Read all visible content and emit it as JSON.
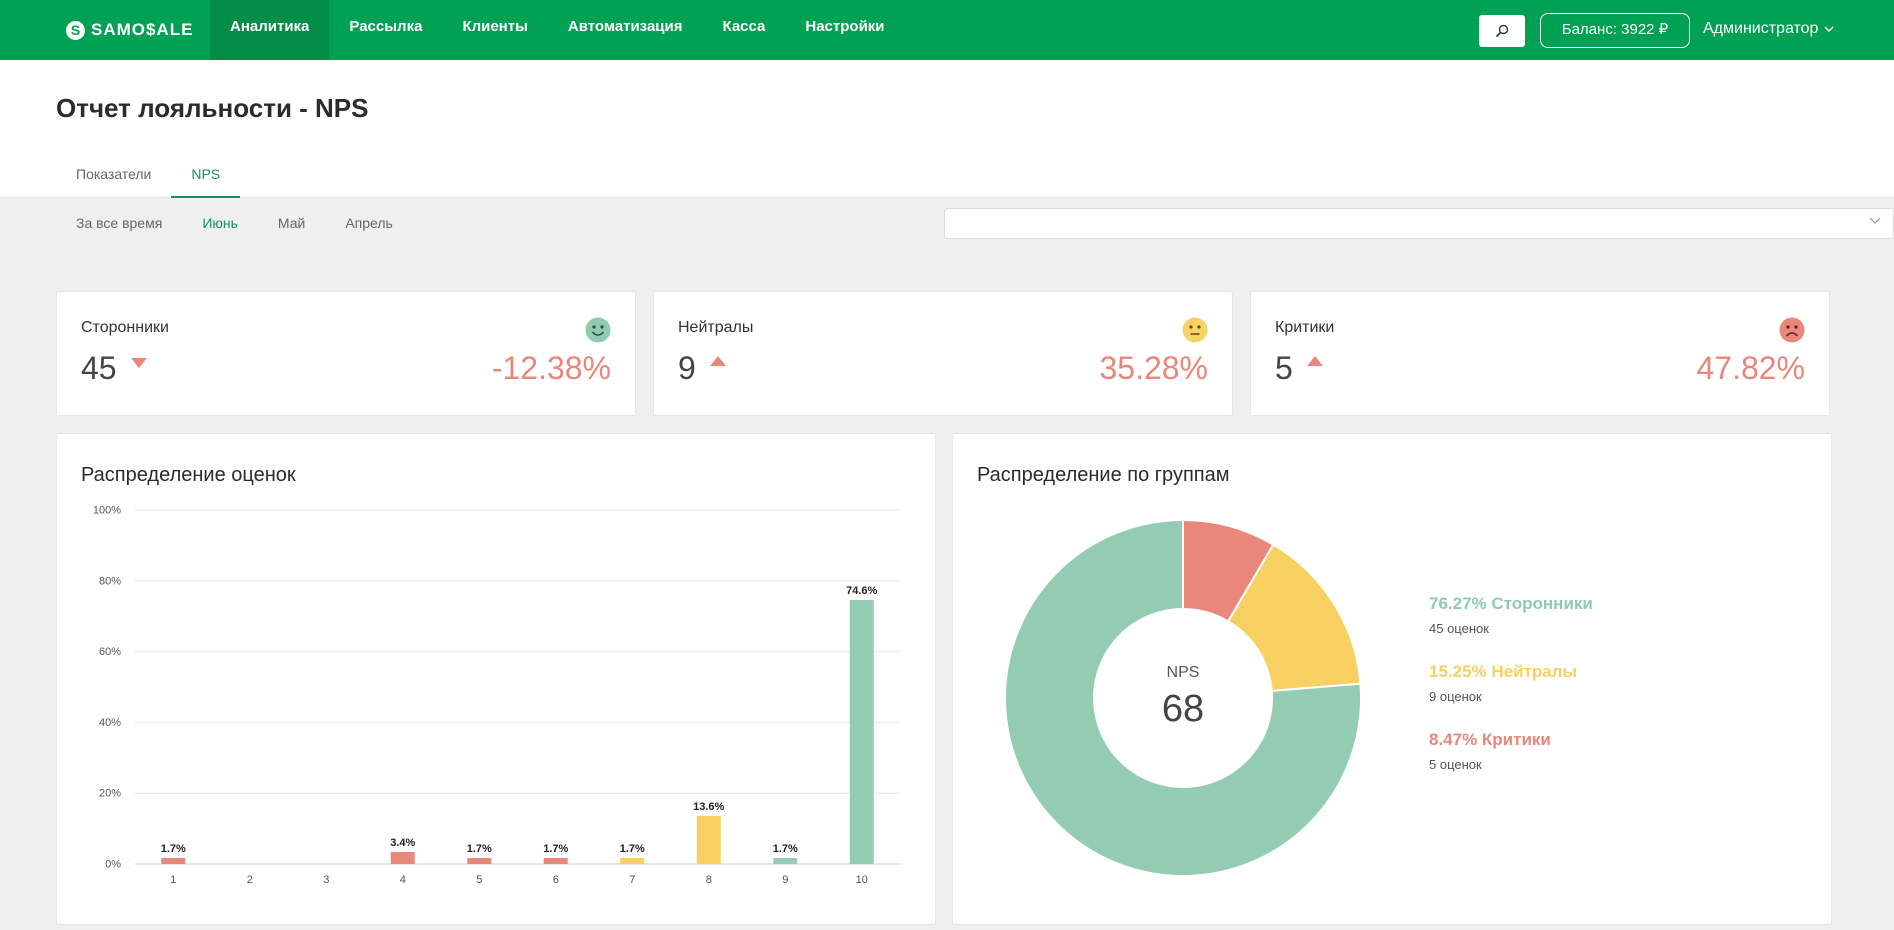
{
  "nav": {
    "logo": "SAMO$ALE",
    "logo_mark": "S",
    "items": [
      {
        "label": "Аналитика",
        "active": true
      },
      {
        "label": "Рассылка",
        "active": false
      },
      {
        "label": "Клиенты",
        "active": false
      },
      {
        "label": "Автоматизация",
        "active": false
      },
      {
        "label": "Касса",
        "active": false
      },
      {
        "label": "Настройки",
        "active": false
      }
    ],
    "search_icon": "search-icon",
    "balance": "Баланс: 3922 ₽",
    "user": "Администратор"
  },
  "page": {
    "title": "Отчет лояльности - NPS",
    "tabs": [
      {
        "label": "Показатели",
        "active": false
      },
      {
        "label": "NPS",
        "active": true
      }
    ]
  },
  "periods": [
    {
      "label": "За все время",
      "active": false
    },
    {
      "label": "Июнь",
      "active": true
    },
    {
      "label": "Май",
      "active": false
    },
    {
      "label": "Апрель",
      "active": false
    }
  ],
  "select": {
    "value": "",
    "icon": "chevron-down-icon"
  },
  "stats": [
    {
      "label": "Сторонники",
      "count": "45",
      "trend": "down",
      "change": "-12.38%",
      "icon": "smile-icon",
      "icon_color": "#8fcbb0"
    },
    {
      "label": "Нейтралы",
      "count": "9",
      "trend": "up",
      "change": "35.28%",
      "icon": "neutral-face-icon",
      "icon_color": "#f7d264"
    },
    {
      "label": "Критики",
      "count": "5",
      "trend": "up",
      "change": "47.82%",
      "icon": "frown-icon",
      "icon_color": "#e8877a"
    }
  ],
  "colors": {
    "brand": "#00a152",
    "promoters": "#93ccb2",
    "neutrals": "#f7d061",
    "detractors": "#e8877a"
  },
  "bar_chart": {
    "title": "Распределение оценок"
  },
  "donut": {
    "title": "Распределение по группам",
    "center_label": "NPS",
    "center_value": "68",
    "legend": [
      {
        "main": "76.27% Сторонники",
        "sub": "45 оценок",
        "color": "#8fcbb0"
      },
      {
        "main": "15.25% Нейтралы",
        "sub": "9 оценок",
        "color": "#f7d061"
      },
      {
        "main": "8.47% Критики",
        "sub": "5 оценок",
        "color": "#e8877a"
      }
    ]
  },
  "chart_data": [
    {
      "type": "bar",
      "title": "Распределение оценок",
      "xlabel": "",
      "ylabel": "",
      "categories": [
        "1",
        "2",
        "3",
        "4",
        "5",
        "6",
        "7",
        "8",
        "9",
        "10"
      ],
      "values": [
        1.7,
        0,
        0,
        3.4,
        1.7,
        1.7,
        1.7,
        13.6,
        1.7,
        74.6
      ],
      "labels": [
        "1.7%",
        "",
        "",
        "3.4%",
        "1.7%",
        "1.7%",
        "1.7%",
        "13.6%",
        "1.7%",
        "74.6%"
      ],
      "bar_colors": [
        "#e8877a",
        "#e8877a",
        "#e8877a",
        "#e8877a",
        "#e8877a",
        "#e8877a",
        "#f7d061",
        "#f7d061",
        "#93ccb2",
        "#93ccb2"
      ],
      "ylim": [
        0,
        100
      ],
      "yticks": [
        "0%",
        "20%",
        "40%",
        "60%",
        "80%",
        "100%"
      ],
      "grid": true
    },
    {
      "type": "pie",
      "title": "Распределение по группам",
      "categories": [
        "Сторонники",
        "Нейтралы",
        "Критики"
      ],
      "values": [
        76.27,
        15.25,
        8.47
      ],
      "colors": [
        "#93ccb2",
        "#f7d061",
        "#e8877a"
      ],
      "donut": true,
      "start": "top",
      "order_clockwise": [
        "Критики",
        "Нейтралы",
        "Сторонники"
      ]
    }
  ]
}
